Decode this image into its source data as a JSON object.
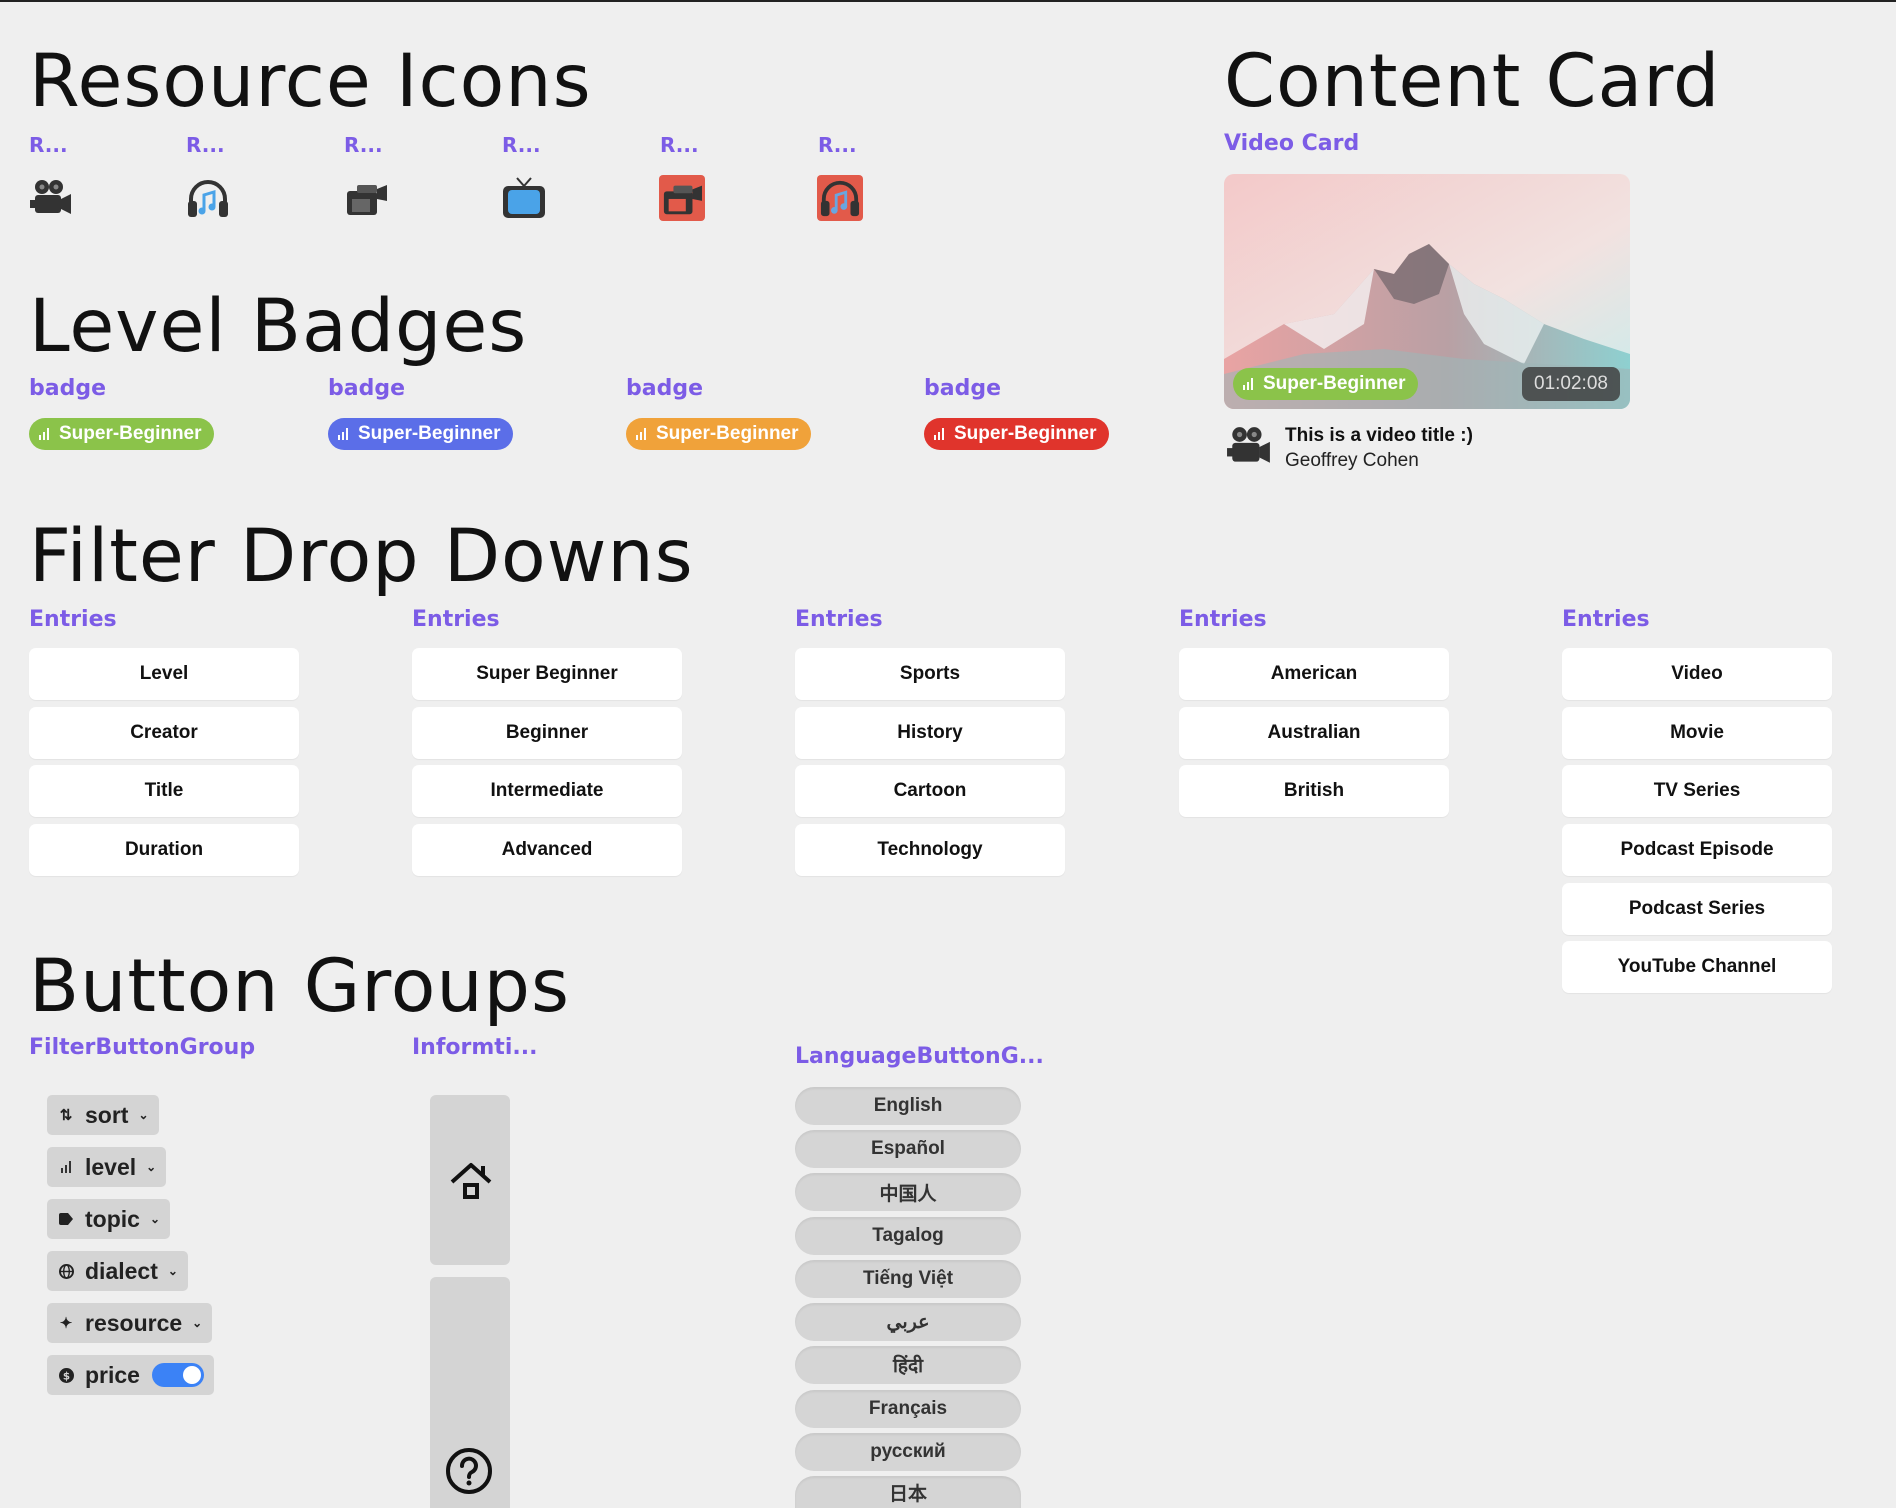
{
  "sections": {
    "resource_icons": {
      "title": "Resource Icons",
      "labels": [
        "R...",
        "R...",
        "R...",
        "R...",
        "R...",
        "R..."
      ]
    },
    "level_badges": {
      "title": "Level Badges",
      "labels": [
        "badge",
        "badge",
        "badge",
        "badge"
      ],
      "badges": [
        {
          "text": "Super-Beginner",
          "color": "#8bc34a"
        },
        {
          "text": "Super-Beginner",
          "color": "#5b6ee8"
        },
        {
          "text": "Super-Beginner",
          "color": "#f0a23a"
        },
        {
          "text": "Super-Beginner",
          "color": "#e0342c"
        }
      ]
    },
    "content_card": {
      "title": "Content Card",
      "subtitle": "Video Card",
      "badge": "Super-Beginner",
      "duration": "01:02:08",
      "video_title": "This is a video title :)",
      "author": "Geoffrey Cohen"
    },
    "filter_dropdowns": {
      "title": "Filter Drop Downs",
      "columns": [
        {
          "label": "Entries",
          "entries": [
            "Level",
            "Creator",
            "Title",
            "Duration"
          ]
        },
        {
          "label": "Entries",
          "entries": [
            "Super Beginner",
            "Beginner",
            "Intermediate",
            "Advanced"
          ]
        },
        {
          "label": "Entries",
          "entries": [
            "Sports",
            "History",
            "Cartoon",
            "Technology"
          ]
        },
        {
          "label": "Entries",
          "entries": [
            "American",
            "Australian",
            "British"
          ]
        },
        {
          "label": "Entries",
          "entries": [
            "Video",
            "Movie",
            "TV Series",
            "Podcast Episode",
            "Podcast Series",
            "YouTube Channel"
          ]
        }
      ]
    },
    "button_groups": {
      "title": "Button Groups",
      "filter_group": {
        "label": "FilterButtonGroup",
        "buttons": [
          {
            "label": "sort",
            "icon": "sort-icon"
          },
          {
            "label": "level",
            "icon": "level-bars-icon"
          },
          {
            "label": "topic",
            "icon": "tag-icon"
          },
          {
            "label": "dialect",
            "icon": "globe-icon"
          },
          {
            "label": "resource",
            "icon": "sparkle-icon"
          },
          {
            "label": "price",
            "icon": "dollar-icon",
            "toggle_on": true
          }
        ]
      },
      "info_group": {
        "label": "Informti...",
        "icons": [
          "home-icon",
          "help-icon"
        ]
      },
      "language_group": {
        "label": "LanguageButtonG...",
        "languages": [
          "English",
          "Español",
          "中国人",
          "Tagalog",
          "Tiếng Việt",
          "عربي",
          "हिंदी",
          "Français",
          "русский",
          "日本"
        ]
      }
    }
  },
  "colors": {
    "accent": "#7c5ce6",
    "background": "#efefef",
    "toggle": "#3b82f6"
  }
}
